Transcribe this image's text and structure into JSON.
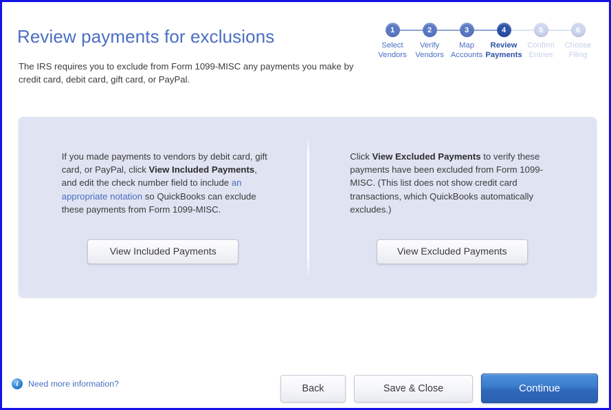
{
  "header": {
    "title": "Review payments for exclusions",
    "intro": "The IRS requires you to exclude from Form 1099-MISC any payments you make by credit card, debit card, gift card, or PayPal."
  },
  "stepper": {
    "steps": [
      {
        "number": "1",
        "label": "Select\nVendors",
        "state": "done"
      },
      {
        "number": "2",
        "label": "Verify\nVendors",
        "state": "done"
      },
      {
        "number": "3",
        "label": "Map\nAccounts",
        "state": "done"
      },
      {
        "number": "4",
        "label": "Review\nPayments",
        "state": "active"
      },
      {
        "number": "5",
        "label": "Confirm\nEntries",
        "state": "dim"
      },
      {
        "number": "6",
        "label": "Choose\nFiling",
        "state": "dim"
      }
    ]
  },
  "panel": {
    "left": {
      "text_1": "If you made payments to vendors by debit card, gift card, or PayPal, click ",
      "bold_1": "View Included Payments",
      "text_2": ", and edit the check number field to include ",
      "link": "an appropriate notation",
      "text_3": " so QuickBooks can exclude these payments from Form 1099-MISC.",
      "button": "View Included Payments"
    },
    "right": {
      "text_1": "Click ",
      "bold_1": "View Excluded Payments",
      "text_2": " to verify these payments have been excluded from Form 1099-MISC. (This list does not show credit card transactions, which QuickBooks automatically excludes.)",
      "button": "View Excluded Payments"
    }
  },
  "footer": {
    "need_info": "Need more information?",
    "info_icon_glyph": "i",
    "back": "Back",
    "save_close": "Save & Close",
    "continue": "Continue"
  },
  "colors": {
    "window_border": "#1414e6",
    "title_blue": "#4a6ec0",
    "panel_bg": "#dfe3f2",
    "step_done": "#5b79c4",
    "step_active": "#2c51a5",
    "step_dim": "#ccd6ef",
    "primary_button": "#3a7bcb",
    "link": "#4a6ec0"
  }
}
